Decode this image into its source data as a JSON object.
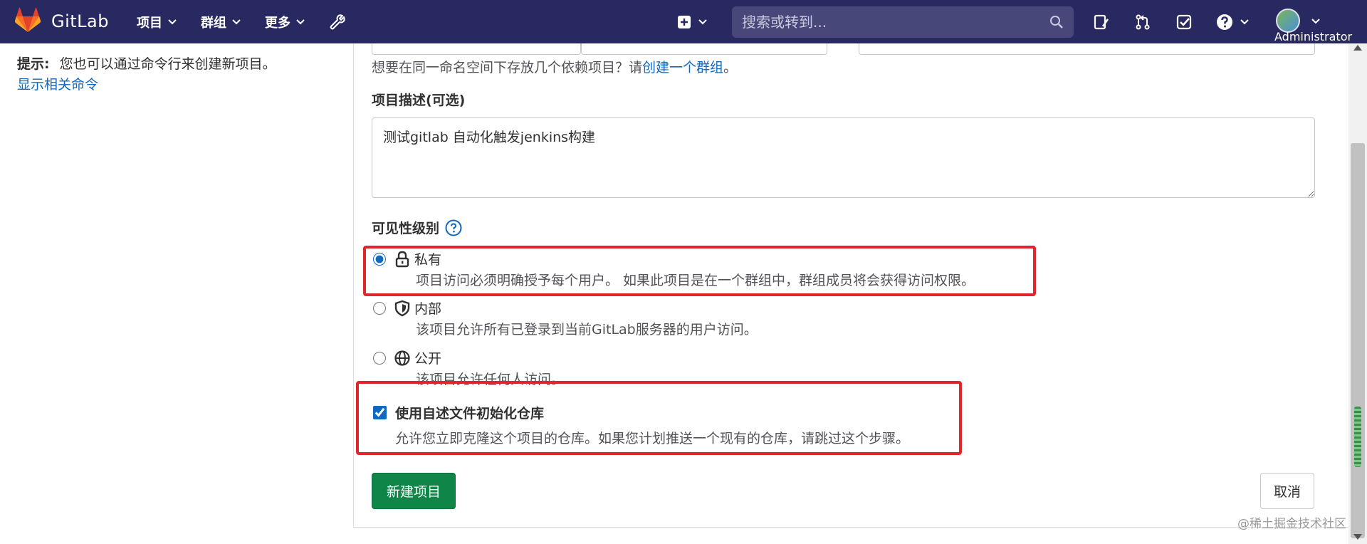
{
  "navbar": {
    "brand": "GitLab",
    "menu": [
      {
        "label": "项目"
      },
      {
        "label": "群组"
      },
      {
        "label": "更多"
      }
    ],
    "search_placeholder": "搜索或转到...",
    "user": "Administrator",
    "colors": {
      "background": "#292961",
      "logo": "#e24329"
    }
  },
  "sidebar": {
    "tip_label": "提示:",
    "tip_text": "您也可以通过命令行来创建新项目。",
    "tip_link": "显示相关命令"
  },
  "form": {
    "namespace_hint_prefix": "想要在同一命名空间下存放几个依赖项目？请",
    "namespace_hint_link": "创建一个群组",
    "namespace_hint_suffix": "。",
    "description_label": "项目描述(可选)",
    "description_value": "测试gitlab 自动化触发jenkins构建",
    "visibility_label": "可见性级别",
    "visibility_options": [
      {
        "title": "私有",
        "desc": "项目访问必须明确授予每个用户。 如果此项目是在一个群组中，群组成员将会获得访问权限。",
        "selected": true,
        "icon": "lock-icon"
      },
      {
        "title": "内部",
        "desc": "该项目允许所有已登录到当前GitLab服务器的用户访问。",
        "selected": false,
        "icon": "shield-icon"
      },
      {
        "title": "公开",
        "desc": "该项目允许任何人访问。",
        "selected": false,
        "icon": "globe-icon"
      }
    ],
    "init_readme_title": "使用自述文件初始化仓库",
    "init_readme_desc": "允许您立即克隆这个项目的仓库。如果您计划推送一个现有的仓库，请跳过这个步骤。",
    "init_readme_checked": true,
    "submit_label": "新建项目",
    "cancel_label": "取消"
  },
  "watermark": "@稀土掘金技术社区",
  "colors": {
    "primary_button": "#108548",
    "link": "#1068bf",
    "highlight": "#e0262b"
  }
}
